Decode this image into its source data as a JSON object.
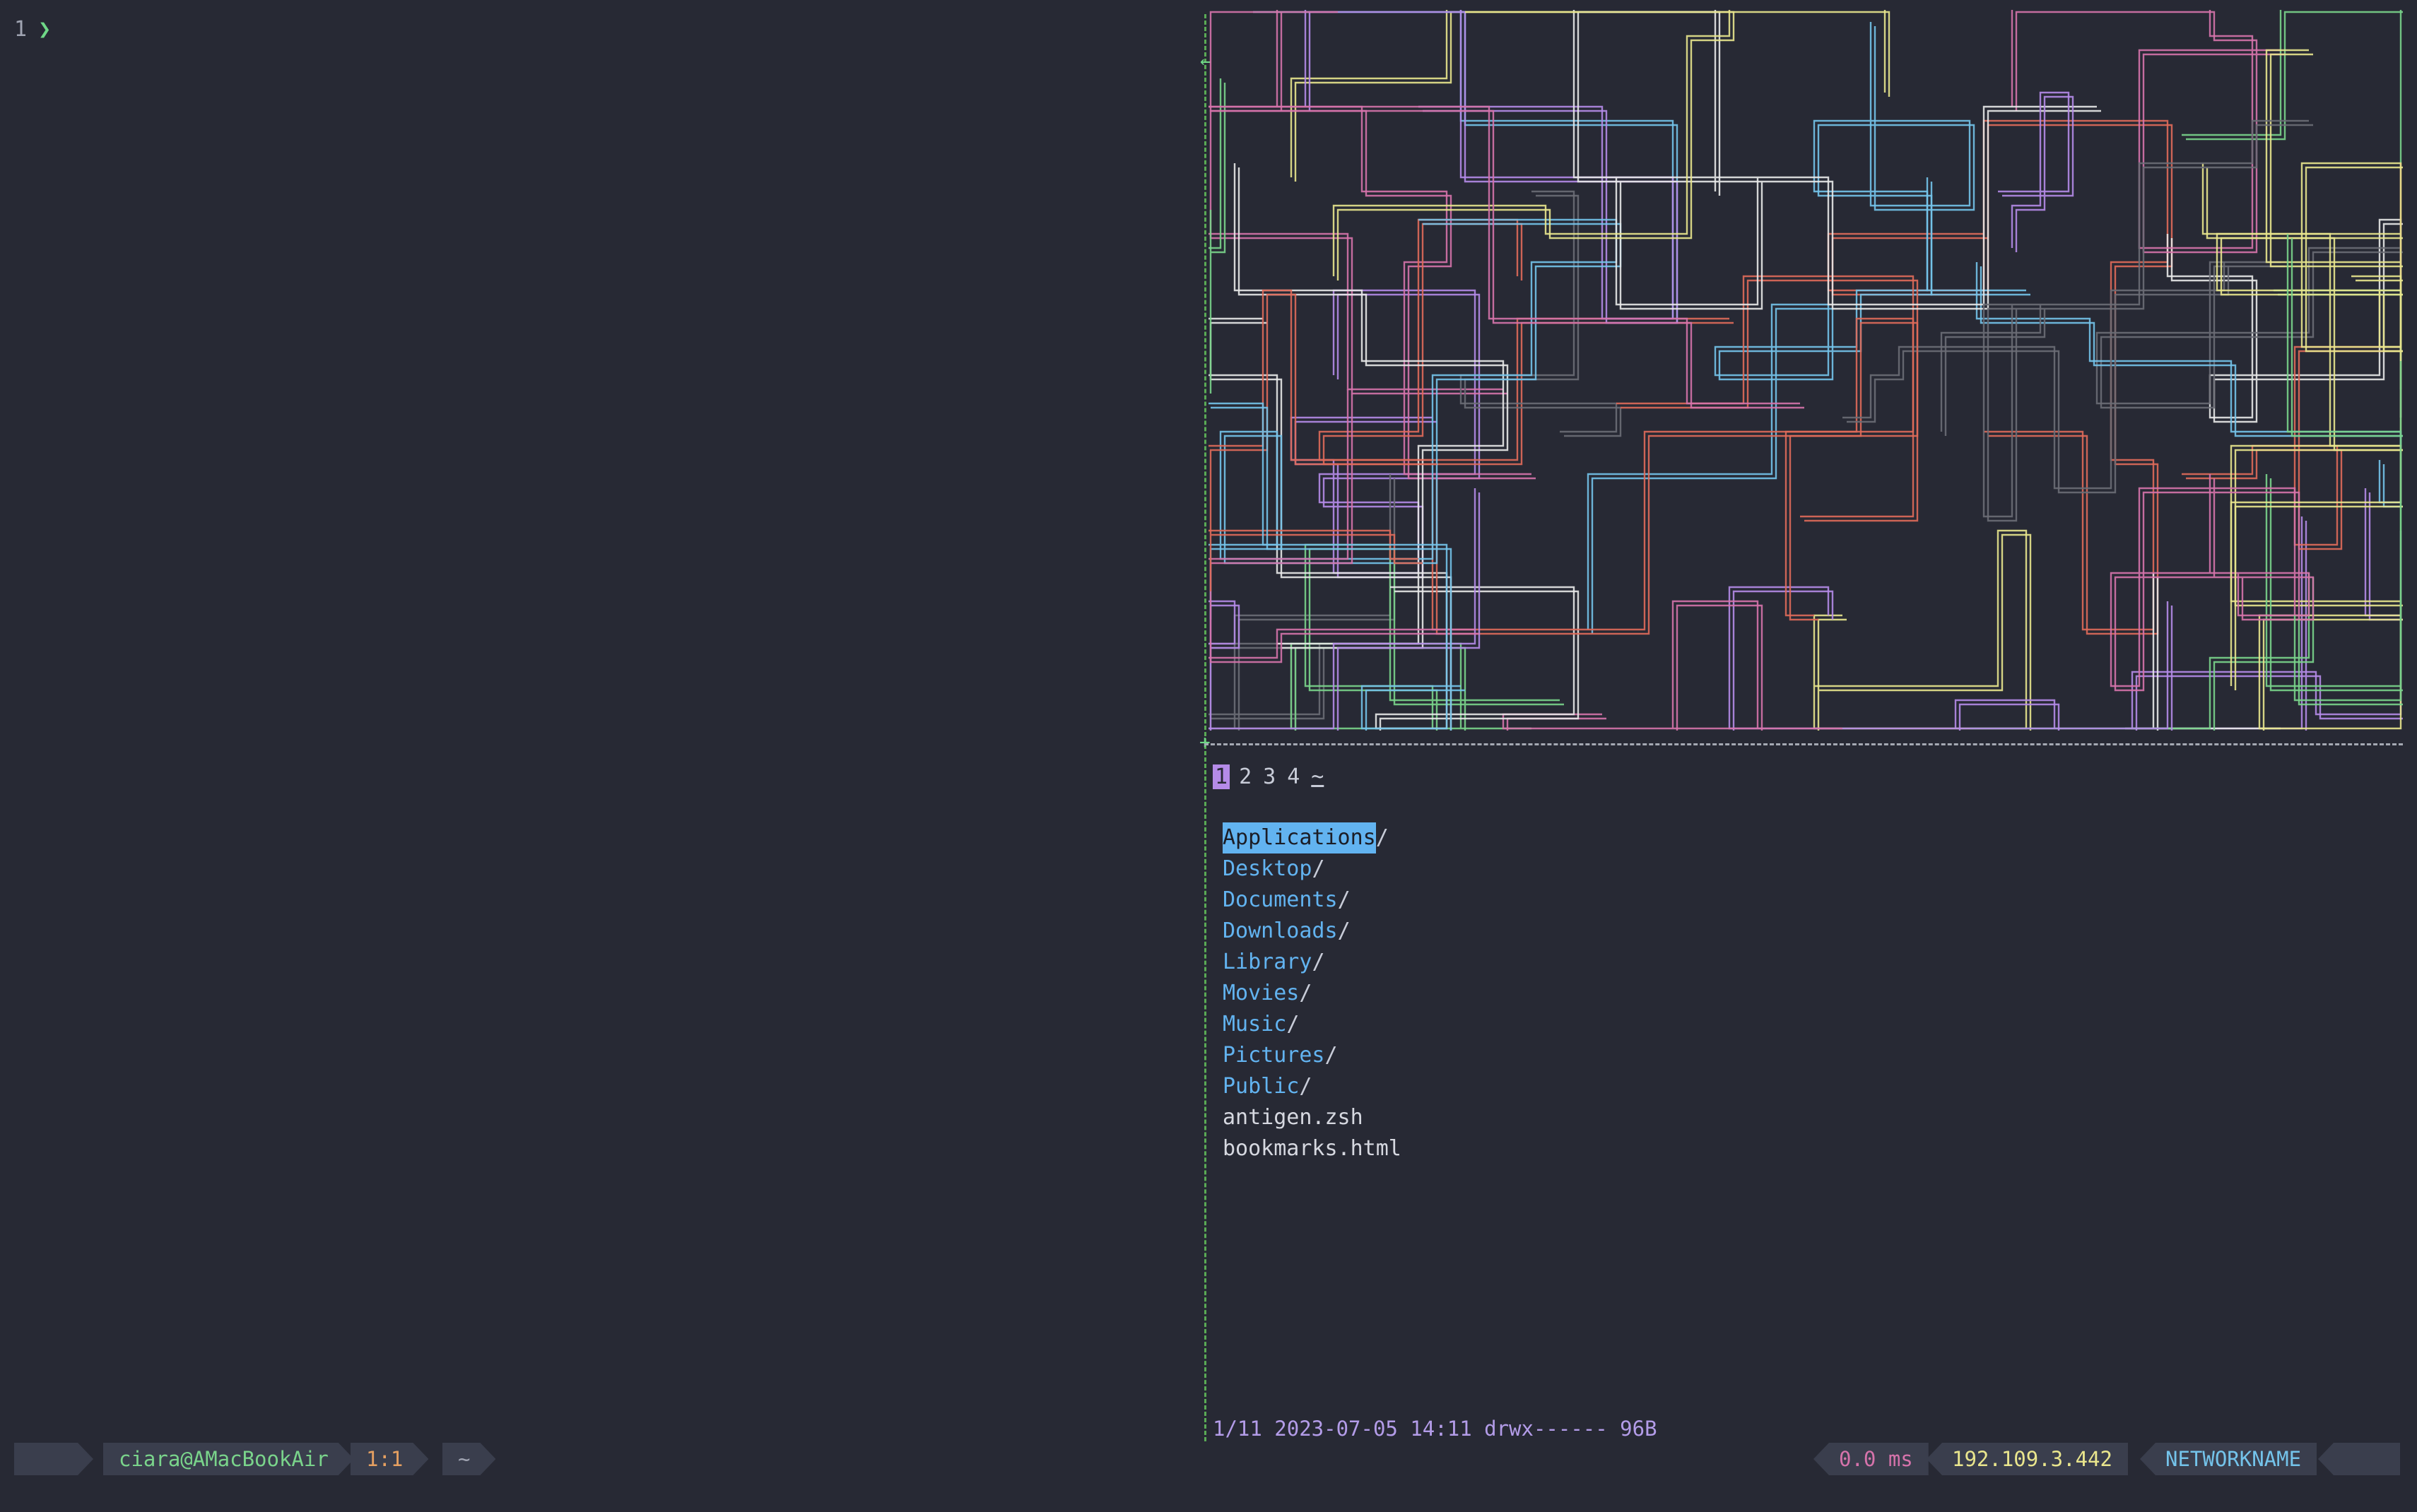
{
  "left_pane": {
    "line_number": "1",
    "prompt_symbol": "❯"
  },
  "art": {
    "name": "pipes",
    "colors": [
      "#e06a5a",
      "#7ad48b",
      "#74c3ea",
      "#e9e58d",
      "#b58be8",
      "#d673ab",
      "#e8e8e8",
      "#6b6d75"
    ]
  },
  "file_browser": {
    "tabs": [
      {
        "label": "1",
        "active": true
      },
      {
        "label": "2",
        "active": false
      },
      {
        "label": "3",
        "active": false
      },
      {
        "label": "4",
        "active": false
      },
      {
        "label": "~",
        "active": false
      }
    ],
    "entries": [
      {
        "name": "Applications",
        "suffix": "/",
        "type": "dir",
        "selected": true
      },
      {
        "name": "Desktop",
        "suffix": "/",
        "type": "dir",
        "selected": false
      },
      {
        "name": "Documents",
        "suffix": "/",
        "type": "dir",
        "selected": false
      },
      {
        "name": "Downloads",
        "suffix": "/",
        "type": "dir",
        "selected": false
      },
      {
        "name": "Library",
        "suffix": "/",
        "type": "dir",
        "selected": false
      },
      {
        "name": "Movies",
        "suffix": "/",
        "type": "dir",
        "selected": false
      },
      {
        "name": "Music",
        "suffix": "/",
        "type": "dir",
        "selected": false
      },
      {
        "name": "Pictures",
        "suffix": "/",
        "type": "dir",
        "selected": false
      },
      {
        "name": "Public",
        "suffix": "/",
        "type": "dir",
        "selected": false
      },
      {
        "name": "antigen.zsh",
        "suffix": "",
        "type": "file",
        "selected": false
      },
      {
        "name": "bookmarks.html",
        "suffix": "",
        "type": "file",
        "selected": false
      }
    ],
    "status": "1/11 2023-07-05 14:11 drwx------ 96B"
  },
  "status_bar": {
    "user_host": "ciara@AMacBookAir",
    "position": "1:1",
    "cwd": "~",
    "latency": "0.0 ms",
    "ip": "192.109.3.442",
    "network": "NETWORKNAME"
  },
  "colors": {
    "background": "#272934",
    "segment_bg": "#3a3e4d",
    "dir": "#62b3f0",
    "accent_green": "#7ad48b",
    "accent_purple": "#b58be8"
  }
}
